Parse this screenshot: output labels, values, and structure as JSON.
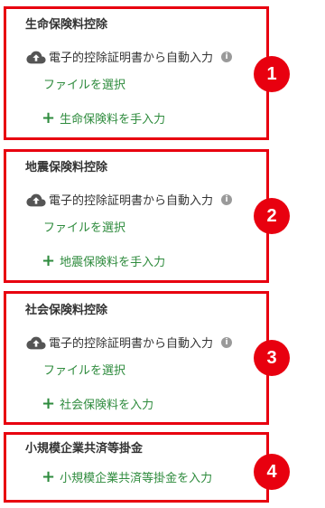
{
  "sections": [
    {
      "title": "生命保険料控除",
      "auto_input_label": "電子的控除証明書から自動入力",
      "info_icon_glyph": "i",
      "file_select_label": "ファイルを選択",
      "manual_add_label": "生命保険料を手入力",
      "badge": "1"
    },
    {
      "title": "地震保険料控除",
      "auto_input_label": "電子的控除証明書から自動入力",
      "info_icon_glyph": "i",
      "file_select_label": "ファイルを選択",
      "manual_add_label": "地震保険料を手入力",
      "badge": "2"
    },
    {
      "title": "社会保険料控除",
      "auto_input_label": "電子的控除証明書から自動入力",
      "info_icon_glyph": "i",
      "file_select_label": "ファイルを選択",
      "manual_add_label": "社会保険料を入力",
      "badge": "3"
    },
    {
      "title": "小規模企業共済等掛金",
      "manual_add_label": "小規模企業共済等掛金を入力",
      "badge": "4"
    }
  ],
  "icons": {
    "upload": "cloud-upload-icon",
    "info": "info-icon",
    "add": "plus-icon"
  },
  "colors": {
    "highlight_border": "#e8000f",
    "badge_bg": "#e8000f",
    "link_green": "#2e8b3d",
    "text_dark": "#333333",
    "info_gray": "#9a9a9a"
  }
}
